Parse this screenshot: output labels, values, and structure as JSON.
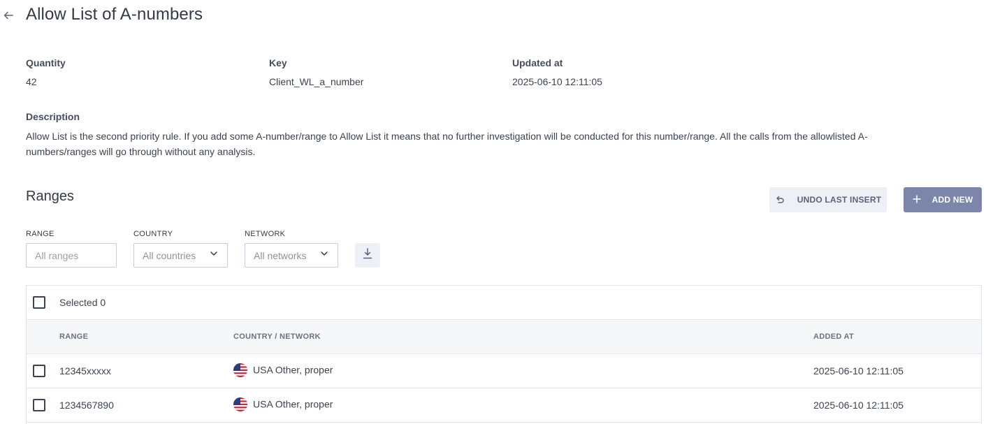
{
  "header": {
    "back_icon": "arrow-left-icon",
    "title": "Allow List of A-numbers"
  },
  "meta": {
    "quantity_label": "Quantity",
    "quantity_value": "42",
    "key_label": "Key",
    "key_value": "Client_WL_a_number",
    "updated_label": "Updated at",
    "updated_value": "2025-06-10 12:11:05"
  },
  "description": {
    "label": "Description",
    "text": "Allow List is the second priority rule. If you add some A-number/range to Allow List it means that no further investigation will be conducted for this number/range. All the calls from the allowlisted A-numbers/ranges will go through without any analysis."
  },
  "ranges": {
    "title": "Ranges",
    "undo_label": "UNDO LAST INSERT",
    "undo_icon": "undo-icon",
    "add_label": "ADD NEW",
    "add_icon": "plus-icon"
  },
  "filters": {
    "range_label": "RANGE",
    "range_placeholder": "All ranges",
    "country_label": "COUNTRY",
    "country_value": "All countries",
    "network_label": "NETWORK",
    "network_value": "All networks",
    "download_icon": "download-icon"
  },
  "table": {
    "selected_text": "Selected 0",
    "columns": [
      "RANGE",
      "COUNTRY / NETWORK",
      "ADDED AT"
    ],
    "rows": [
      {
        "range": "12345xxxxx",
        "country_network": "USA Other, proper",
        "flag": "us-flag-icon",
        "added_at": "2025-06-10 12:11:05"
      },
      {
        "range": "1234567890",
        "country_network": "USA Other, proper",
        "flag": "us-flag-icon",
        "added_at": "2025-06-10 12:11:05"
      }
    ]
  },
  "colors": {
    "primary_button": "#7c86ab",
    "secondary_button": "#eef0f5",
    "text": "#333a45",
    "border": "#e1e4ea"
  }
}
